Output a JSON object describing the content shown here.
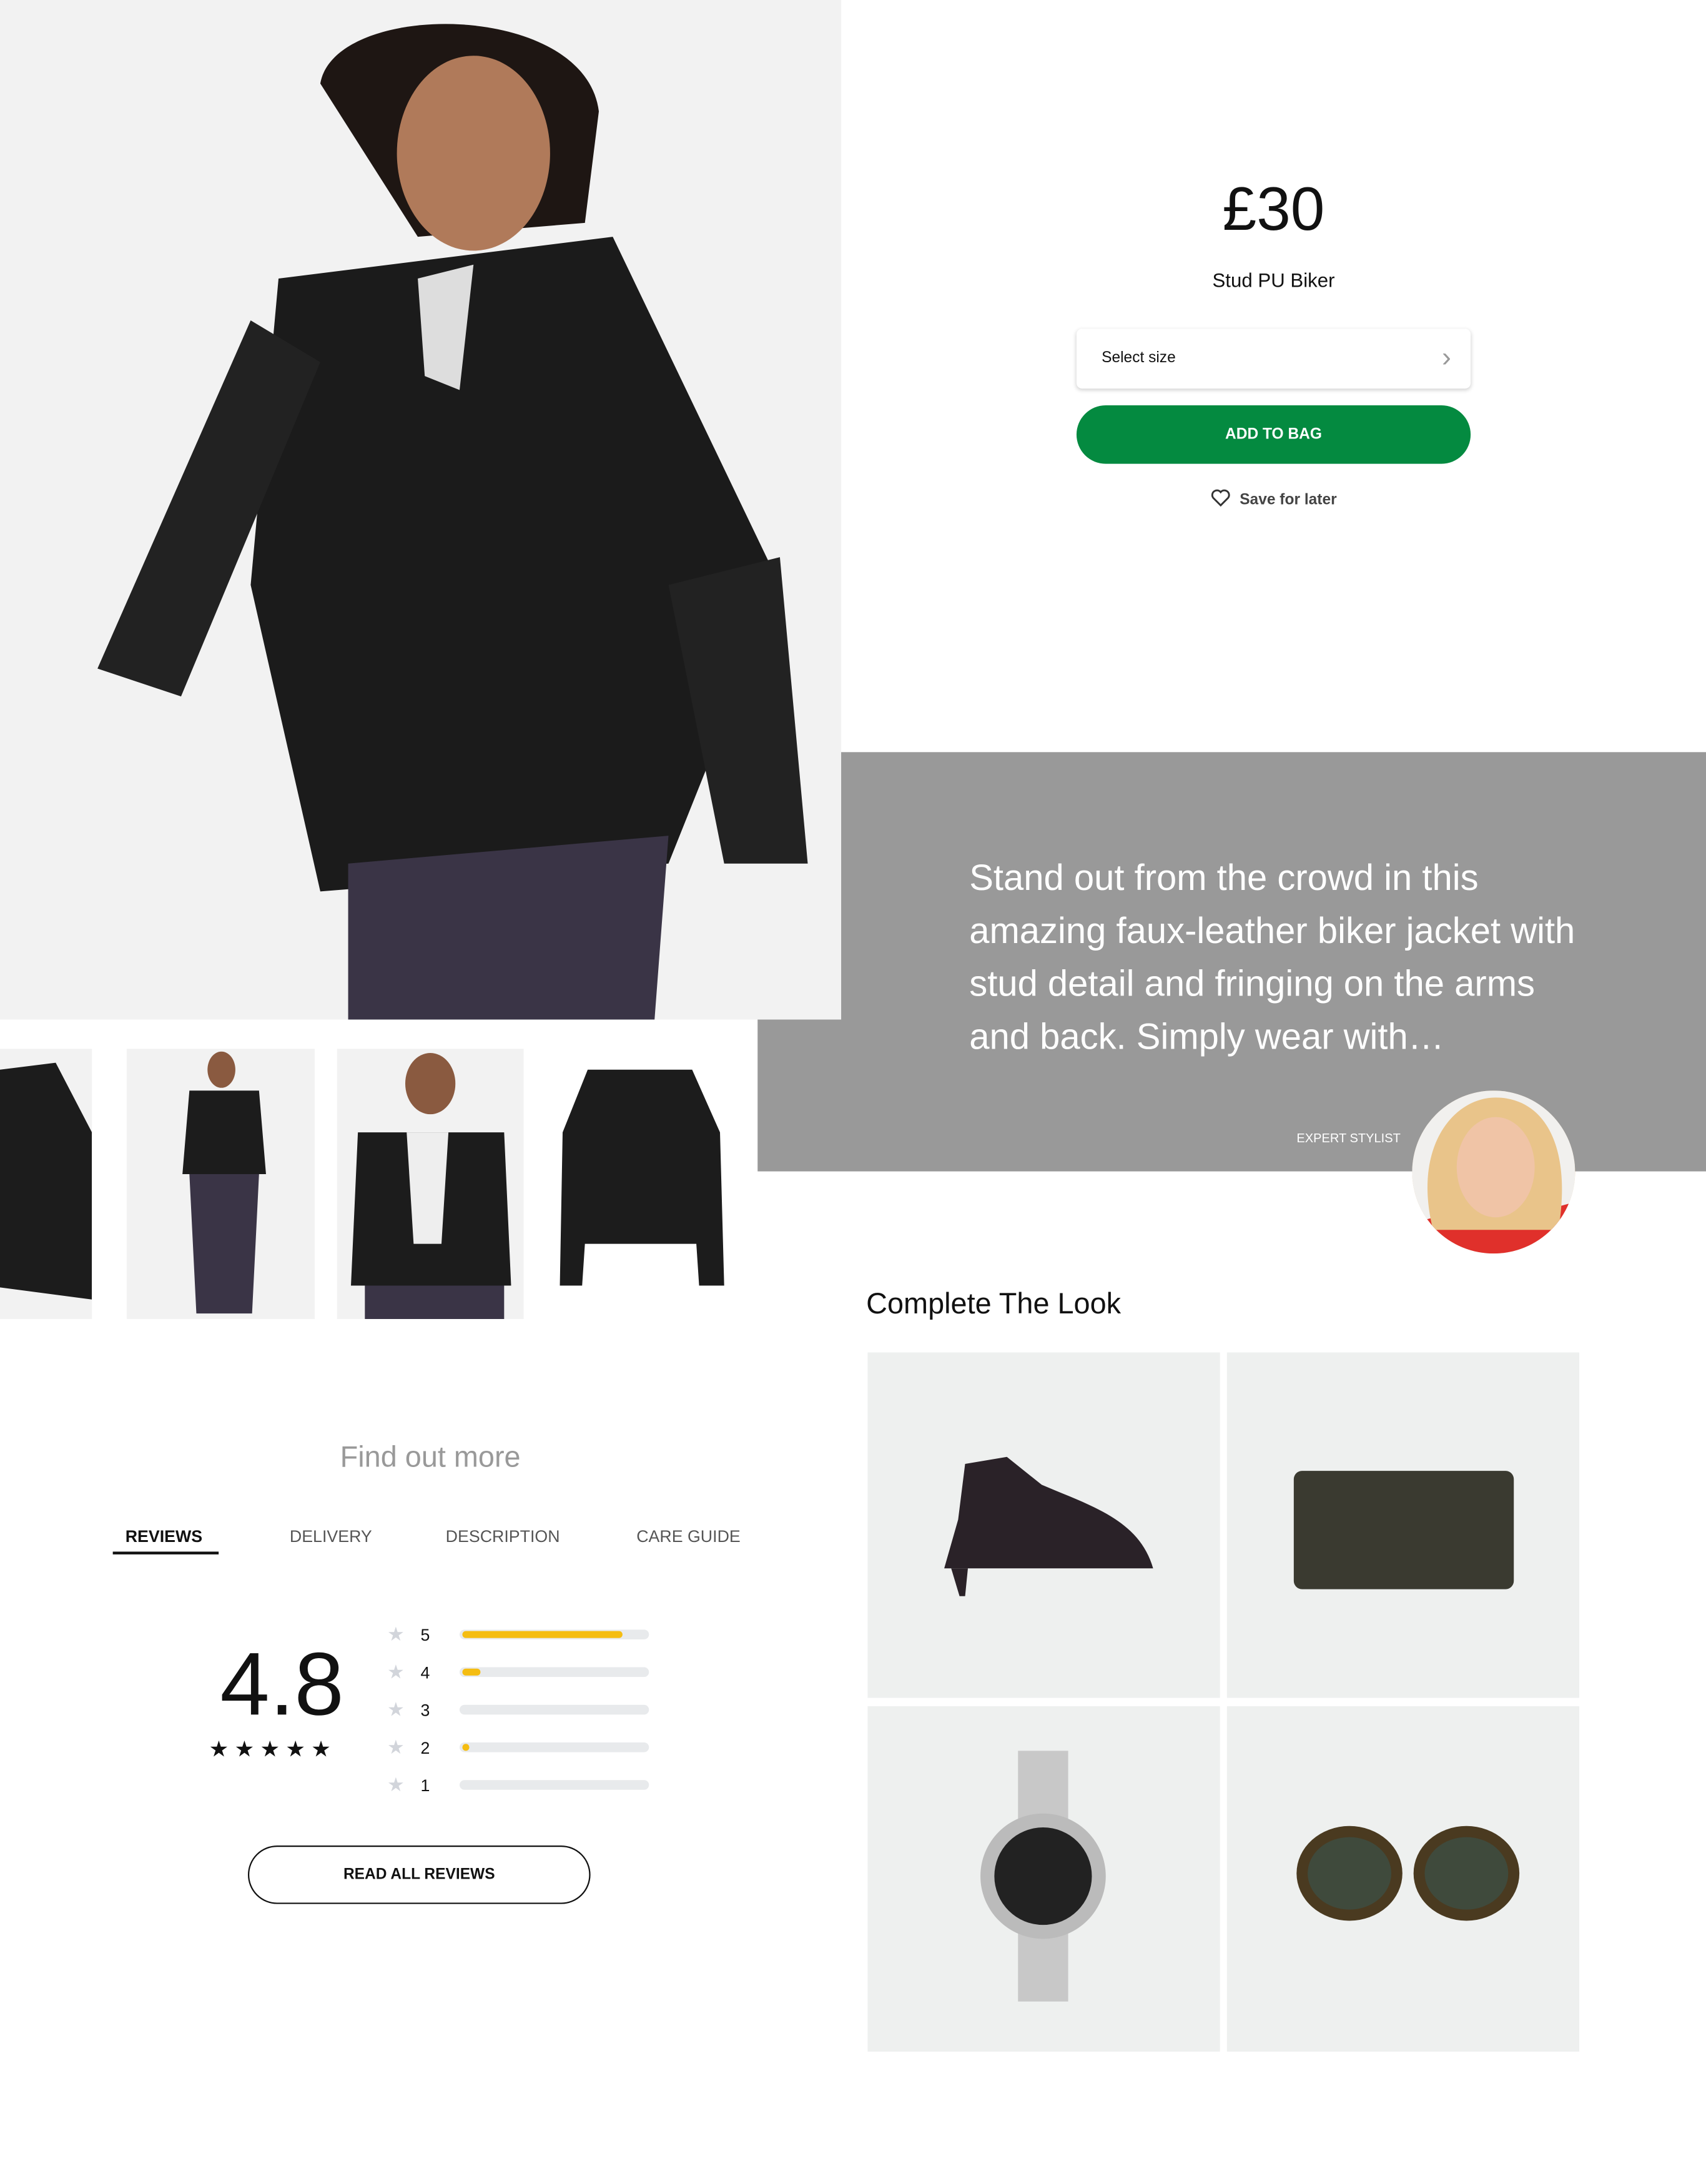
{
  "product": {
    "price": "£30",
    "title": "Stud PU Biker",
    "size_select": {
      "label": "Select size",
      "icon": "chevron-right-icon"
    },
    "add_to_bag": "ADD TO BAG",
    "save_for_later": {
      "label": "Save for later",
      "icon": "heart-icon"
    },
    "accent_color": "#048a40"
  },
  "stylist": {
    "quote": "Stand out from the crowd in this amazing faux-leather biker jacket with stud detail and fringing on the arms and back. Simply wear with…",
    "label": "EXPERT STYLIST",
    "panel_color": "#999999"
  },
  "find_out_more": {
    "title": "Find out more",
    "tabs": [
      {
        "label": "REVIEWS",
        "active": true
      },
      {
        "label": "DELIVERY",
        "active": false
      },
      {
        "label": "DESCRIPTION",
        "active": false
      },
      {
        "label": "CARE GUIDE",
        "active": false
      }
    ]
  },
  "reviews": {
    "average": "4.8",
    "stars": "★★★★★",
    "breakdown": [
      {
        "stars": "5",
        "fraction": 0.86
      },
      {
        "stars": "4",
        "fraction": 0.1
      },
      {
        "stars": "3",
        "fraction": 0
      },
      {
        "stars": "2",
        "fraction": 0.03
      },
      {
        "stars": "1",
        "fraction": 0
      }
    ],
    "bar_color": "#f5bd12",
    "read_all": "READ ALL REVIEWS"
  },
  "complete_the_look": {
    "title": "Complete The Look",
    "items": [
      "ankle-boot",
      "purse",
      "watch",
      "sunglasses"
    ]
  }
}
